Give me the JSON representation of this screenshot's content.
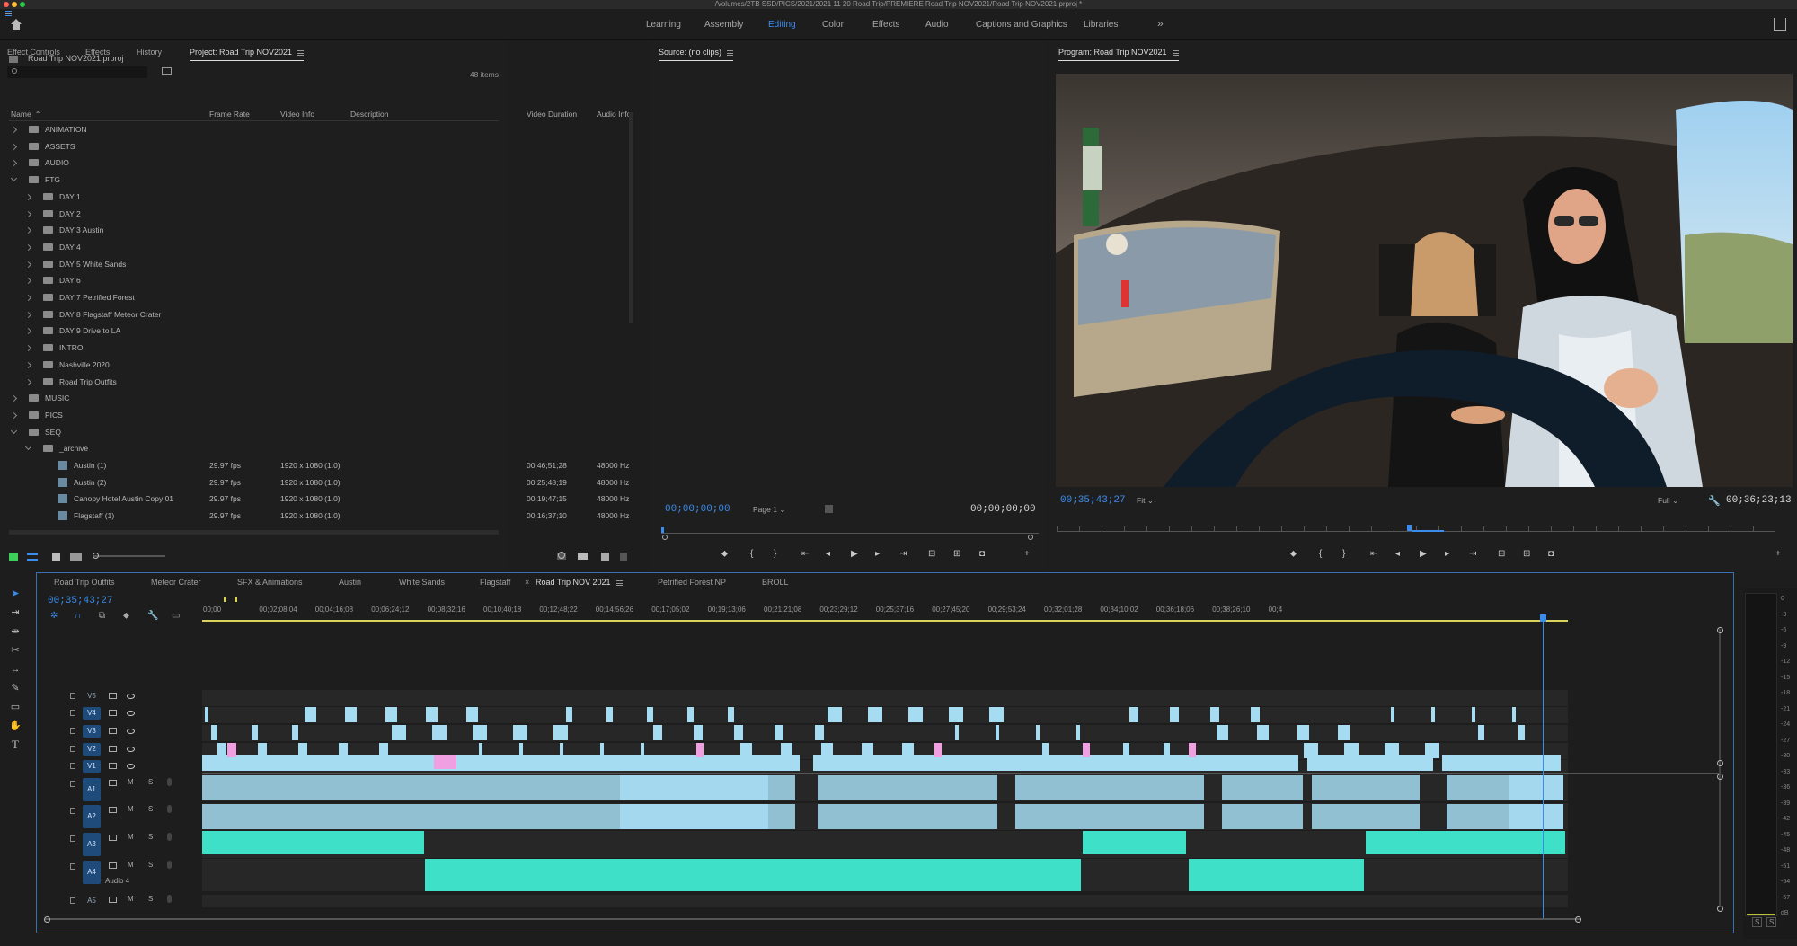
{
  "window": {
    "title": "/Volumes/2TB SSD/PICS/2021/2021 11 20 Road Trip/PREMIERE Road Trip NOV2021/Road Trip NOV2021.prproj *"
  },
  "workspaces": {
    "items": [
      {
        "label": "Learning",
        "active": false
      },
      {
        "label": "Assembly",
        "active": false
      },
      {
        "label": "Editing",
        "active": true
      },
      {
        "label": "Color",
        "active": false
      },
      {
        "label": "Effects",
        "active": false
      },
      {
        "label": "Audio",
        "active": false
      },
      {
        "label": "Captions and Graphics",
        "active": false
      },
      {
        "label": "Libraries",
        "active": false
      }
    ],
    "more": "»"
  },
  "project_panel": {
    "tabs": [
      "Effect Controls",
      "Effects",
      "History",
      "Project: Road Trip NOV2021"
    ],
    "file": "Road Trip NOV2021.prproj",
    "search_placeholder": "",
    "item_count": "48 items",
    "columns": [
      "Name",
      "Frame Rate",
      "Video Info",
      "Description",
      "Video Duration",
      "Audio Info"
    ],
    "rows": [
      {
        "name": "ANIMATION",
        "level": 0,
        "type": "folder",
        "open": false
      },
      {
        "name": "ASSETS",
        "level": 0,
        "type": "folder",
        "open": false
      },
      {
        "name": "AUDIO",
        "level": 0,
        "type": "folder",
        "open": false
      },
      {
        "name": "FTG",
        "level": 0,
        "type": "folder",
        "open": true
      },
      {
        "name": "DAY 1",
        "level": 1,
        "type": "folder",
        "open": false
      },
      {
        "name": "DAY 2",
        "level": 1,
        "type": "folder",
        "open": false
      },
      {
        "name": "DAY 3 Austin",
        "level": 1,
        "type": "folder",
        "open": false
      },
      {
        "name": "DAY 4",
        "level": 1,
        "type": "folder",
        "open": false
      },
      {
        "name": "DAY 5 White Sands",
        "level": 1,
        "type": "folder",
        "open": false
      },
      {
        "name": "DAY 6",
        "level": 1,
        "type": "folder",
        "open": false
      },
      {
        "name": "DAY 7 Petrified Forest",
        "level": 1,
        "type": "folder",
        "open": false
      },
      {
        "name": "DAY 8 Flagstaff Meteor Crater",
        "level": 1,
        "type": "folder",
        "open": false
      },
      {
        "name": "DAY 9 Drive to LA",
        "level": 1,
        "type": "folder",
        "open": false
      },
      {
        "name": "INTRO",
        "level": 1,
        "type": "folder",
        "open": false
      },
      {
        "name": "Nashville 2020",
        "level": 1,
        "type": "folder",
        "open": false
      },
      {
        "name": "Road Trip Outfits",
        "level": 1,
        "type": "folder",
        "open": false
      },
      {
        "name": "MUSIC",
        "level": 0,
        "type": "folder",
        "open": false
      },
      {
        "name": "PICS",
        "level": 0,
        "type": "folder",
        "open": false
      },
      {
        "name": "SEQ",
        "level": 0,
        "type": "folder",
        "open": true
      },
      {
        "name": "_archive",
        "level": 1,
        "type": "folder",
        "open": true
      },
      {
        "name": "Austin (1)",
        "level": 2,
        "type": "sequence",
        "fps": "29.97 fps",
        "video": "1920 x 1080 (1.0)",
        "duration": "00;46;51;28",
        "audio": "48000 Hz"
      },
      {
        "name": "Austin (2)",
        "level": 2,
        "type": "sequence",
        "fps": "29.97 fps",
        "video": "1920 x 1080 (1.0)",
        "duration": "00;25;48;19",
        "audio": "48000 Hz"
      },
      {
        "name": "Canopy Hotel Austin Copy 01",
        "level": 2,
        "type": "sequence",
        "fps": "29.97 fps",
        "video": "1920 x 1080 (1.0)",
        "duration": "00;19;47;15",
        "audio": "48000 Hz"
      },
      {
        "name": "Flagstaff (1)",
        "level": 2,
        "type": "sequence",
        "fps": "29.97 fps",
        "video": "1920 x 1080 (1.0)",
        "duration": "00;16;37;10",
        "audio": "48000 Hz"
      }
    ]
  },
  "source_monitor": {
    "title": "Source: (no clips)",
    "timecode_in": "00;00;00;00",
    "page": "Page 1",
    "timecode_out": "00;00;00;00"
  },
  "program_monitor": {
    "title": "Program: Road Trip NOV2021",
    "timecode": "00;35;43;27",
    "fit": "Fit",
    "quality": "Full",
    "duration": "00;36;23;13"
  },
  "timeline": {
    "tabs": [
      {
        "label": "Road Trip Outfits",
        "active": false
      },
      {
        "label": "Meteor Crater",
        "active": false
      },
      {
        "label": "SFX & Animations",
        "active": false
      },
      {
        "label": "Austin",
        "active": false
      },
      {
        "label": "White Sands",
        "active": false
      },
      {
        "label": "Flagstaff",
        "active": false
      },
      {
        "label": "Road Trip NOV 2021",
        "active": true
      },
      {
        "label": "Petrified Forest NP",
        "active": false
      },
      {
        "label": "BROLL",
        "active": false
      }
    ],
    "close_glyph": "×",
    "timecode": "00;35;43;27",
    "ruler": [
      "00;00",
      "00;02;08;04",
      "00;04;16;08",
      "00;06;24;12",
      "00;08;32;16",
      "00;10;40;18",
      "00;12;48;22",
      "00;14;56;26",
      "00;17;05;02",
      "00;19;13;06",
      "00;21;21;08",
      "00;23;29;12",
      "00;25;37;16",
      "00;27;45;20",
      "00;29;53;24",
      "00;32;01;28",
      "00;34;10;02",
      "00;36;18;06",
      "00;38;26;10",
      "00;4"
    ],
    "video_tracks": [
      "V5",
      "V4",
      "V3",
      "V2",
      "V1"
    ],
    "audio_tracks": [
      "A1",
      "A2",
      "A3",
      "A4",
      "A5"
    ],
    "audio4_name": "Audio 4",
    "mute": "M",
    "solo": "S"
  },
  "meter": {
    "labels": [
      "0",
      "-3",
      "-6",
      "-9",
      "-12",
      "-15",
      "-18",
      "-21",
      "-24",
      "-27",
      "-30",
      "-33",
      "-36",
      "-39",
      "-42",
      "-45",
      "-48",
      "-51",
      "-54",
      "-57",
      "dB"
    ],
    "solo": [
      "S",
      "S"
    ]
  },
  "colors": {
    "accent": "#3b8ded",
    "video_clip": "#a6dcf2",
    "music_clip": "#3fe0c8",
    "marker": "#f0a0e0"
  }
}
